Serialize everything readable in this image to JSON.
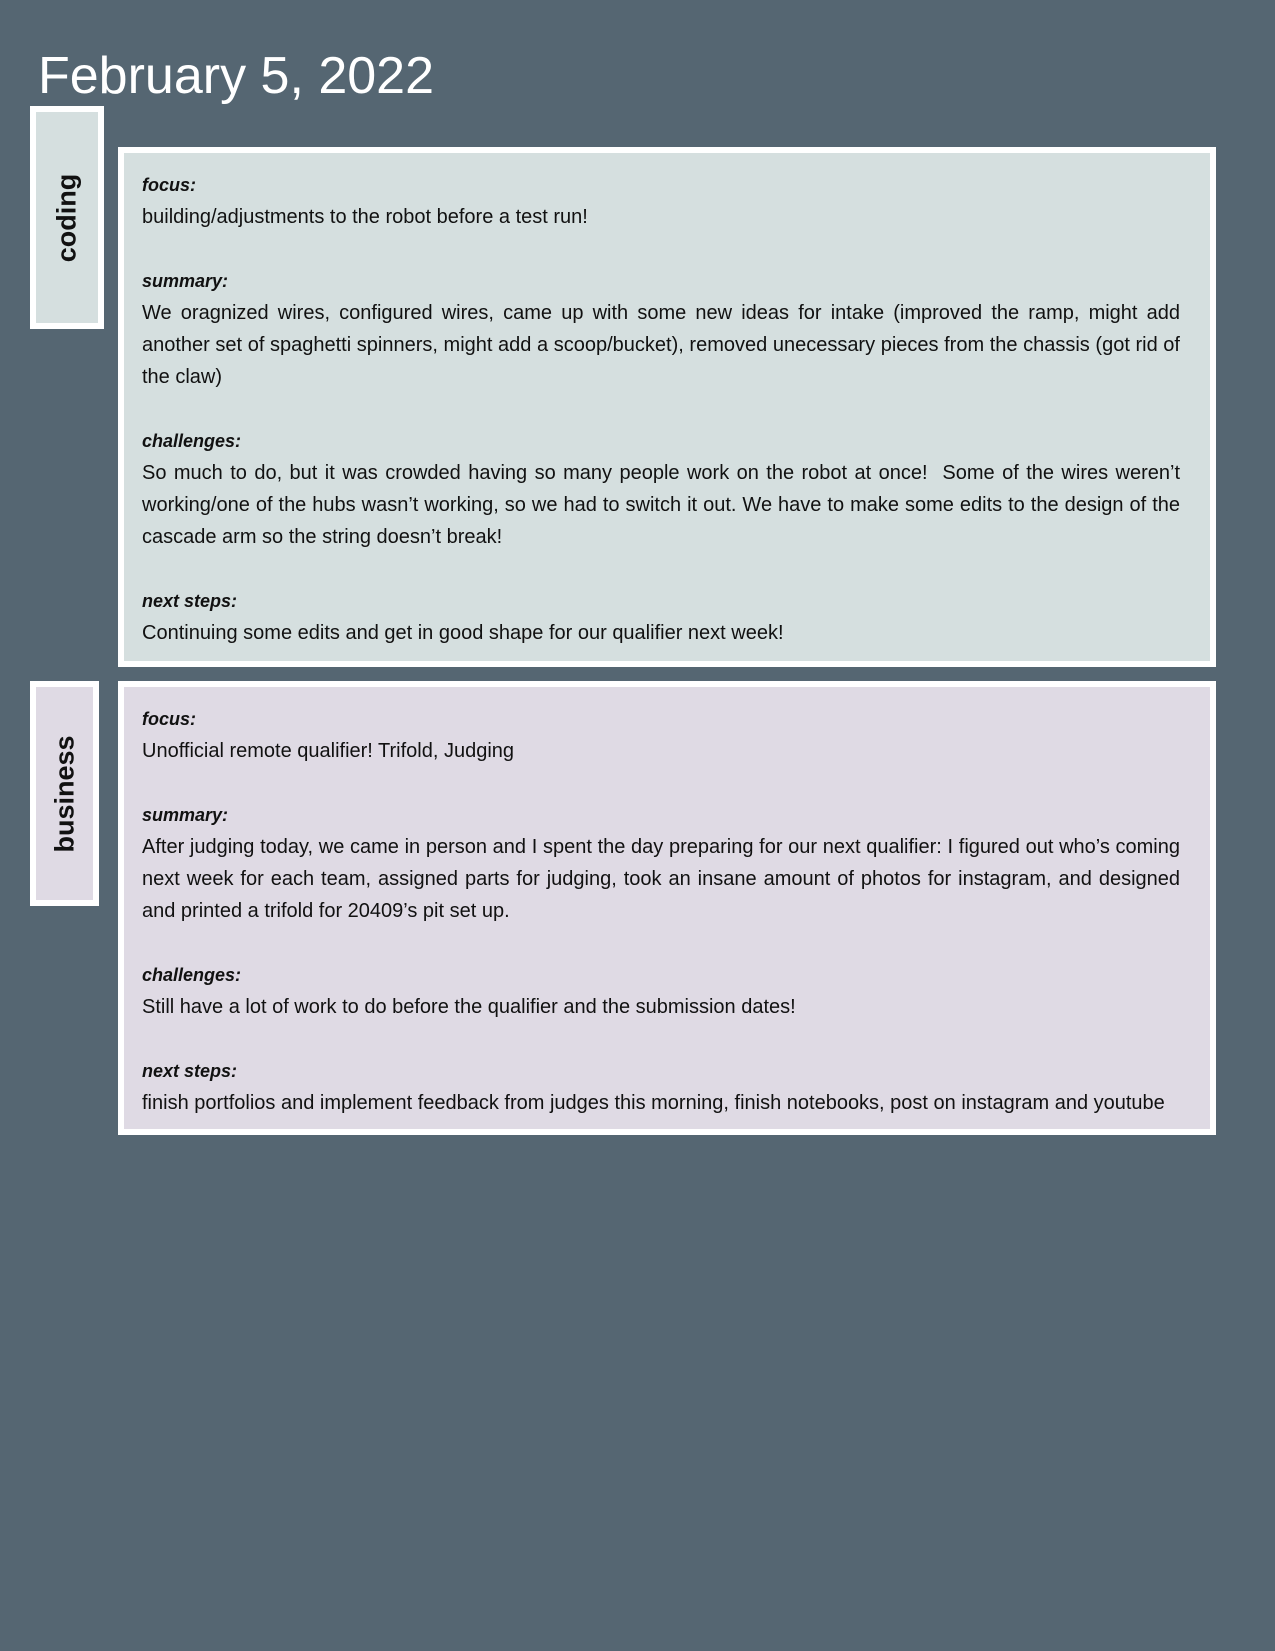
{
  "date": "February 5, 2022",
  "colors": {
    "background": "#556672",
    "coding_fill": "#d5dfdf",
    "business_fill": "#dfdae4",
    "border": "#ffffff"
  },
  "sections": [
    {
      "tab": "coding",
      "fields": [
        {
          "label": "focus:",
          "text": "building/adjustments to the robot before a test run!"
        },
        {
          "label": "summary:",
          "text": "We oragnized wires, configured wires, came up with some new ideas for intake (improved the ramp, might add another set of spaghetti spinners, might add a scoop/bucket), removed unecessary pieces from the chassis (got rid of the claw)"
        },
        {
          "label": "challenges:",
          "text": "So much to do, but it was crowded having so many people work on the robot at once!  Some of the wires weren’t working/one of the hubs wasn’t working, so we had to switch it out. We have to make some edits to the design of the cascade arm so the string doesn’t break!"
        },
        {
          "label": "next steps:",
          "text": "Continuing some edits and get in good shape for our qualifier next week!"
        }
      ]
    },
    {
      "tab": "business",
      "fields": [
        {
          "label": "focus:",
          "text": "Unofficial remote qualifier! Trifold, Judging"
        },
        {
          "label": "summary:",
          "text": "After judging today, we came in person and I spent the day preparing for our next qualifier: I figured out who’s coming next week for each team, assigned parts for judging, took an insane amount of photos for instagram, and designed and printed a trifold for 20409’s pit set up."
        },
        {
          "label": "challenges:",
          "text": "Still have a lot of work to do before the qualifier and the submission dates!"
        },
        {
          "label": "next steps:",
          "text": "finish portfolios and implement feedback from judges this morning, finish notebooks, post on instagram and youtube"
        }
      ]
    }
  ]
}
